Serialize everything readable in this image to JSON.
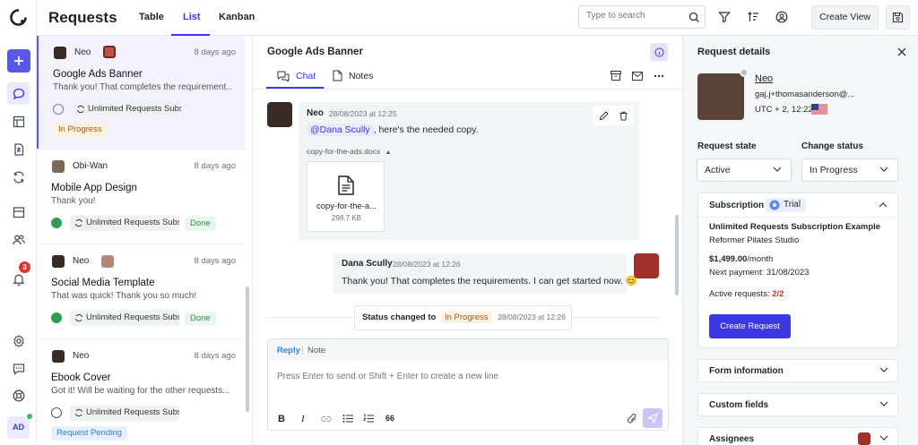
{
  "app": {
    "title": "Requests",
    "user_initials": "AD",
    "notif_count": "3"
  },
  "tabs": [
    {
      "label": "Table"
    },
    {
      "label": "List"
    },
    {
      "label": "Kanban"
    }
  ],
  "search": {
    "placeholder": "Type to search"
  },
  "toolbar": {
    "create_view_label": "Create View"
  },
  "list": {
    "cards": [
      {
        "author": "Neo",
        "time": "8 days ago",
        "title": "Google Ads Banner",
        "message": "Thank you! That completes the requirement...",
        "subscription": "Unlimited Requests Subs",
        "status": "In Progress"
      },
      {
        "author": "Obi-Wan",
        "time": "8 days ago",
        "title": "Mobile App Design",
        "message": "Thank you!",
        "subscription": "Unlimited Requests Subs",
        "status": "Done"
      },
      {
        "author": "Neo",
        "time": "8 days ago",
        "title": "Social Media Template",
        "message": "That was quick! Thank you so much!",
        "subscription": "Unlimited Requests Subs",
        "status": "Done"
      },
      {
        "author": "Neo",
        "time": "8 days ago",
        "title": "Ebook Cover",
        "message": "Got it! Will be waiting for the other requests...",
        "subscription": "Unlimited Requests Subs",
        "status": "Request Pending"
      }
    ]
  },
  "chat": {
    "title": "Google Ads Banner",
    "tabs": [
      {
        "label": "Chat"
      },
      {
        "label": "Notes"
      }
    ],
    "messages": [
      {
        "author": "Neo",
        "time": "28/08/2023 at 12:25",
        "mention": "@Dana Scully",
        "text": ", here's the needed copy.",
        "attachment_label": "copy-for-the-ads.docx",
        "file_name": "copy-for-the-a...",
        "file_size": "298.7 KB"
      },
      {
        "author": "Dana Scully",
        "time": "28/08/2023 at 12:26",
        "text": "Thank you! That completes the requirements. I can get started now. 😊"
      }
    ],
    "status_change": {
      "prefix": "Status changed to",
      "status": "In Progress",
      "time": "28/08/2023 at 12:26"
    },
    "composer": {
      "reply_tab": "Reply",
      "note_tab": "Note",
      "placeholder": "Press Enter to send or Shift + Enter to create a new line",
      "quote_label": "66"
    }
  },
  "details": {
    "title": "Request details",
    "user": {
      "name": "Neo",
      "email": "gaj.j+thomasanderson@...",
      "timezone": "UTC + 2, 12:22"
    },
    "request_state": {
      "label": "Request state",
      "value": "Active"
    },
    "change_status": {
      "label": "Change status",
      "value": "In Progress"
    },
    "subscription": {
      "label": "Subscription",
      "badge": "Trial",
      "plan": "Unlimited Requests Subscription Example",
      "company": "Reformer Pilates Studio",
      "price": "$1,499.00",
      "period": "/month",
      "next_payment": "Next payment: 31/08/2023",
      "active_label": "Active requests: ",
      "active_value": "2/2",
      "create_label": "Create Request"
    },
    "sections": [
      {
        "label": "Form information"
      },
      {
        "label": "Custom fields"
      },
      {
        "label": "Assignees"
      }
    ]
  },
  "colors": {
    "accent": "#3b37e6",
    "brand": "#5b57e8"
  }
}
